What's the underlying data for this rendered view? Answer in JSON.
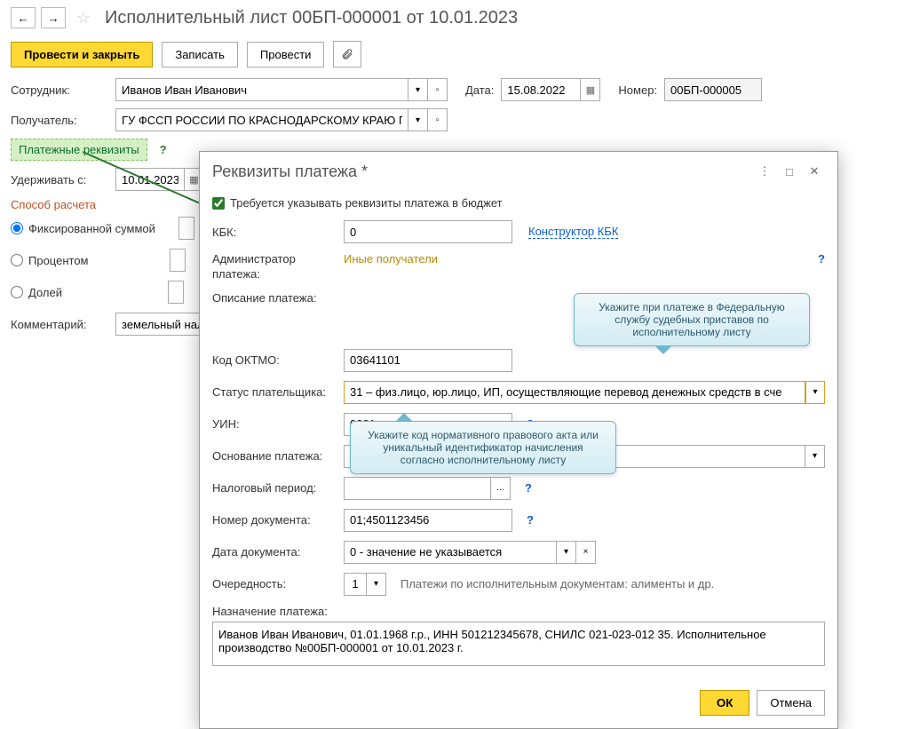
{
  "titlebar": {
    "title": "Исполнительный лист 00БП-000001 от 10.01.2023"
  },
  "toolbar": {
    "conduct_close": "Провести и закрыть",
    "save": "Записать",
    "conduct": "Провести"
  },
  "form": {
    "employee_label": "Сотрудник:",
    "employee_value": "Иванов Иван Иванович",
    "date_label": "Дата:",
    "date_value": "15.08.2022",
    "number_label": "Номер:",
    "number_value": "00БП-000005",
    "recipient_label": "Получатель:",
    "recipient_value": "ГУ ФССП РОССИИ ПО КРАСНОДАРСКОМУ КРАЮ Примс",
    "payment_details_link": "Платежные реквизиты",
    "withhold_from_label": "Удерживать с:",
    "withhold_from_value": "10.01.2023",
    "calc_method_title": "Способ расчета",
    "radio_fixed": "Фиксированной суммой",
    "radio_percent": "Процентом",
    "radio_share": "Долей",
    "comment_label": "Комментарий:",
    "comment_value": "земельный налог"
  },
  "modal": {
    "title": "Реквизиты платежа *",
    "checkbox_label": "Требуется указывать реквизиты платежа в бюджет",
    "kbk_label": "КБК:",
    "kbk_value": "0",
    "kbk_constructor": "Конструктор КБК",
    "admin_label": "Администратор платежа:",
    "admin_value": "Иные получатели",
    "desc_label": "Описание платежа:",
    "oktmo_label": "Код ОКТМО:",
    "oktmo_value": "03641101",
    "payer_status_label": "Статус плательщика:",
    "payer_status_value": "31 – физ.лицо, юр.лицо, ИП, осуществляющие перевод денежных средств в сче",
    "uin_label": "УИН:",
    "uin_value": "0001",
    "basis_label": "Основание платежа:",
    "basis_value": "",
    "tax_period_label": "Налоговый период:",
    "tax_period_value": "",
    "doc_number_label": "Номер документа:",
    "doc_number_value": "01;4501123456",
    "doc_date_label": "Дата документа:",
    "doc_date_value": "0 - значение не указывается",
    "priority_label": "Очередность:",
    "priority_value": "1",
    "priority_desc": "Платежи по исполнительным документам: алименты и др.",
    "purpose_label": "Назначение платежа:",
    "purpose_value": "Иванов Иван Иванович, 01.01.1968 г.р., ИНН 501212345678, СНИЛС 021-023-012 35. Исполнительное производство №00БП-000001 от 10.01.2023 г.",
    "ok": "ОК",
    "cancel": "Отмена"
  },
  "tips": {
    "tip1": "Укажите при платеже в Федеральную службу судебных приставов по исполнительному листу",
    "tip2": "Укажите код нормативного правового акта или уникальный идентификатор начисления согласно исполнительному листу"
  }
}
